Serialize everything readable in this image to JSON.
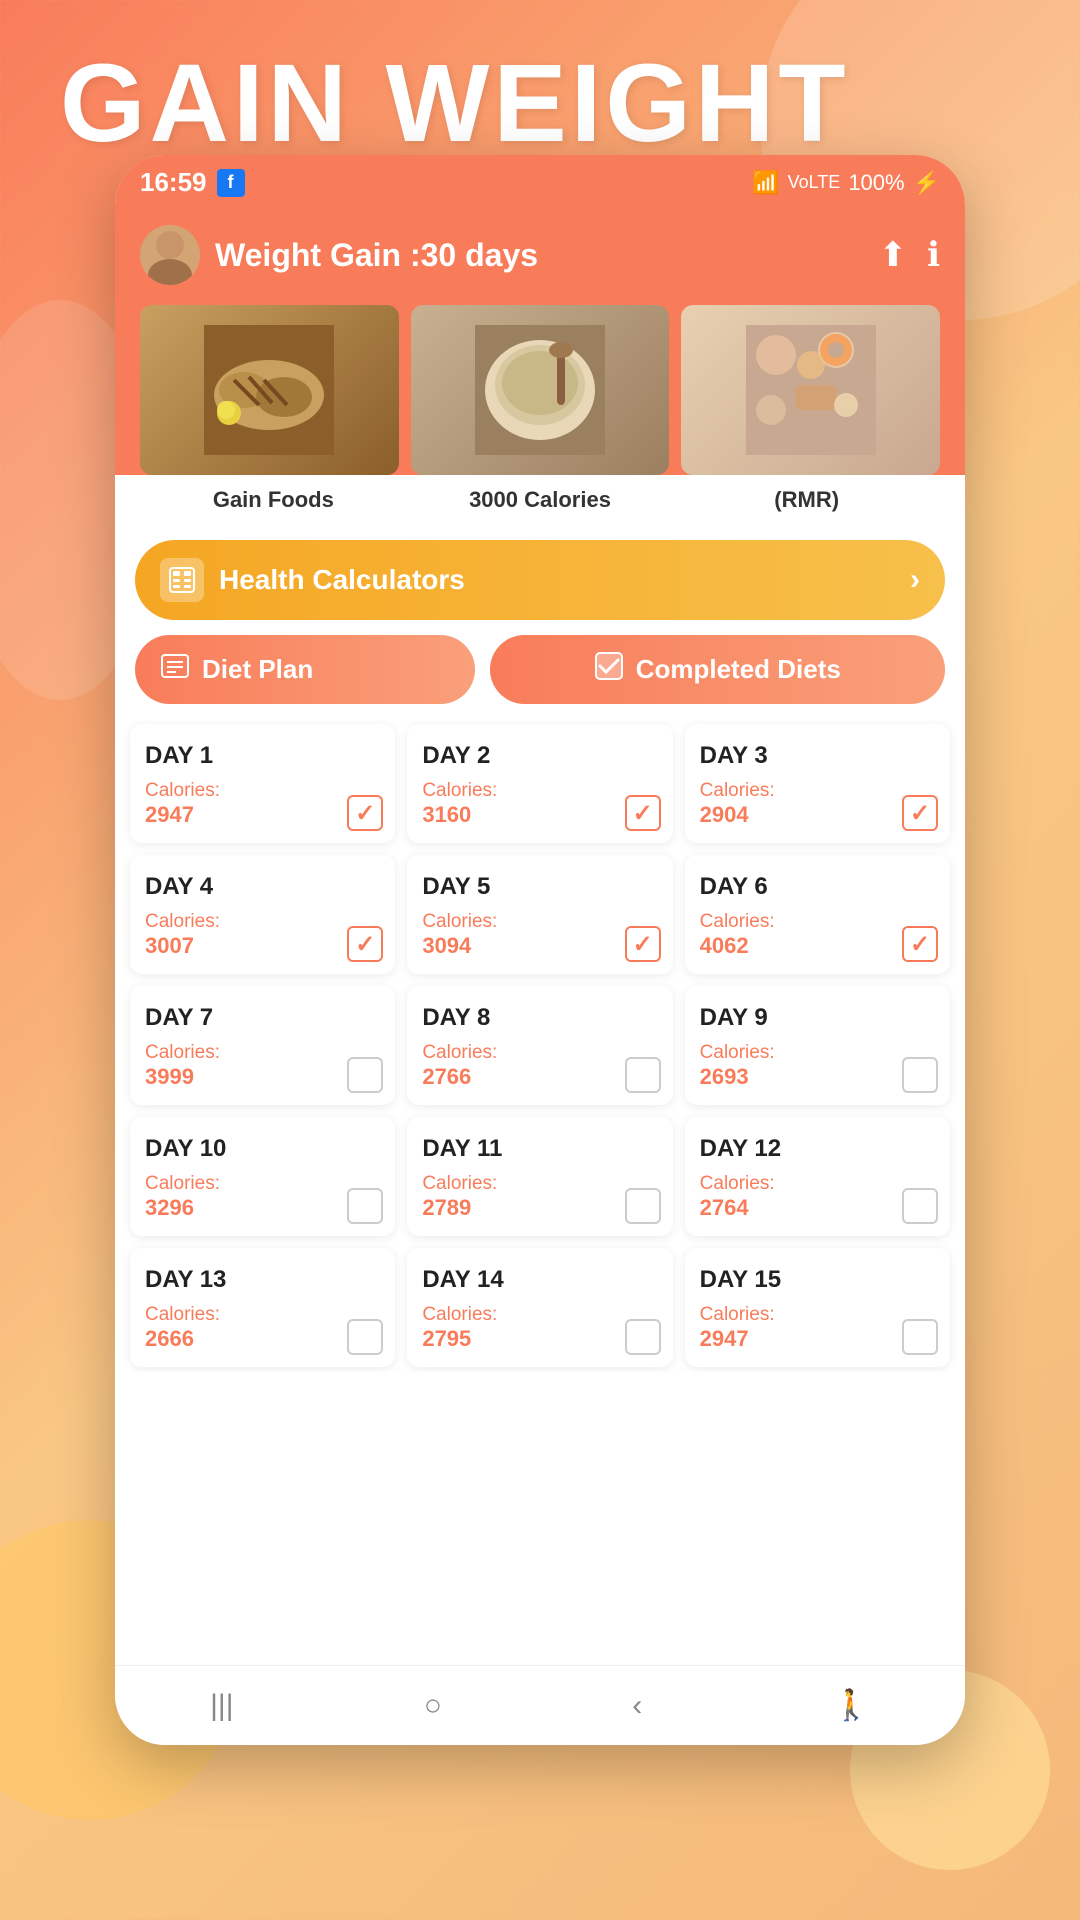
{
  "page": {
    "title": "GAIN WEIGHT",
    "background_gradient_start": "#f97c5a",
    "background_gradient_end": "#f9c784"
  },
  "status_bar": {
    "time": "16:59",
    "battery": "100%",
    "signal": "VoLTE"
  },
  "header": {
    "title": "Weight Gain :30 days",
    "share_label": "share",
    "info_label": "info"
  },
  "food_categories": [
    {
      "label": "Gain Foods",
      "emoji": "🍗",
      "bg": "grilled"
    },
    {
      "label": "3000 Calories",
      "emoji": "🥣",
      "bg": "oats"
    },
    {
      "label": "(RMR)",
      "emoji": "🍪",
      "bg": "snacks"
    }
  ],
  "health_calculators": {
    "label": "Health Calculators",
    "icon": "🧮",
    "chevron": "›"
  },
  "buttons": {
    "diet_plan": "Diet Plan",
    "completed_diets": "Completed Diets"
  },
  "days": [
    {
      "day": "DAY 1",
      "calories_label": "Calories:",
      "calories": "2947",
      "checked": true
    },
    {
      "day": "DAY 2",
      "calories_label": "Calories:",
      "calories": "3160",
      "checked": true
    },
    {
      "day": "DAY 3",
      "calories_label": "Calories:",
      "calories": "2904",
      "checked": true
    },
    {
      "day": "DAY 4",
      "calories_label": "Calories:",
      "calories": "3007",
      "checked": true
    },
    {
      "day": "DAY 5",
      "calories_label": "Calories:",
      "calories": "3094",
      "checked": true
    },
    {
      "day": "DAY 6",
      "calories_label": "Calories:",
      "calories": "4062",
      "checked": true
    },
    {
      "day": "DAY 7",
      "calories_label": "Calories:",
      "calories": "3999",
      "checked": false
    },
    {
      "day": "DAY 8",
      "calories_label": "Calories:",
      "calories": "2766",
      "checked": false
    },
    {
      "day": "DAY 9",
      "calories_label": "Calories:",
      "calories": "2693",
      "checked": false
    },
    {
      "day": "DAY 10",
      "calories_label": "Calories:",
      "calories": "3296",
      "checked": false
    },
    {
      "day": "DAY 11",
      "calories_label": "Calories:",
      "calories": "2789",
      "checked": false
    },
    {
      "day": "DAY 12",
      "calories_label": "Calories:",
      "calories": "2764",
      "checked": false
    },
    {
      "day": "DAY 13",
      "calories_label": "Calories:",
      "calories": "2666",
      "checked": false
    },
    {
      "day": "DAY 14",
      "calories_label": "Calories:",
      "calories": "2795",
      "checked": false
    },
    {
      "day": "DAY 15",
      "calories_label": "Calories:",
      "calories": "2947",
      "checked": false
    }
  ],
  "nav": {
    "items": [
      "|||",
      "○",
      "‹",
      "🚶"
    ]
  }
}
